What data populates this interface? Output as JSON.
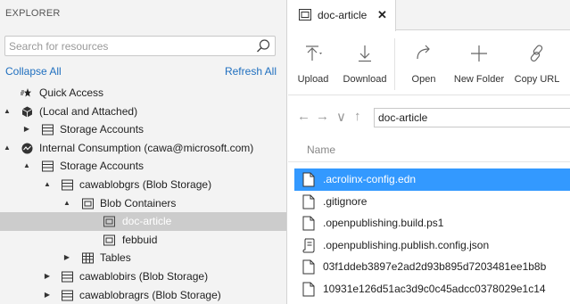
{
  "explorer": {
    "title": "EXPLORER",
    "search_placeholder": "Search for resources",
    "collapse_all": "Collapse All",
    "refresh_all": "Refresh All",
    "tree": [
      {
        "label": "Quick Access",
        "icon": "quick-access-icon",
        "caret": ""
      },
      {
        "label": "(Local and Attached)",
        "icon": "local-attached-icon",
        "caret": "▲"
      },
      {
        "label": "Storage Accounts",
        "icon": "storage-accounts-icon",
        "caret": "▶"
      },
      {
        "label": "Internal Consumption (cawa@microsoft.com)",
        "icon": "subscription-icon",
        "caret": "▲"
      },
      {
        "label": "Storage Accounts",
        "icon": "storage-accounts-icon",
        "caret": "▲"
      },
      {
        "label": "cawablobgrs (Blob Storage)",
        "icon": "storage-account-icon",
        "caret": "▲"
      },
      {
        "label": "Blob Containers",
        "icon": "blob-containers-icon",
        "caret": "▲"
      },
      {
        "label": "doc-article",
        "icon": "container-icon",
        "caret": "",
        "selected": true
      },
      {
        "label": "febbuid",
        "icon": "container-icon",
        "caret": ""
      },
      {
        "label": "Tables",
        "icon": "tables-icon",
        "caret": "▶"
      },
      {
        "label": "cawablobirs (Blob Storage)",
        "icon": "storage-account-icon",
        "caret": "▶"
      },
      {
        "label": "cawablobragrs (Blob Storage)",
        "icon": "storage-account-icon",
        "caret": "▶"
      }
    ]
  },
  "tab": {
    "label": "doc-article",
    "close": "✕"
  },
  "toolbar": {
    "upload": "Upload",
    "download": "Download",
    "open": "Open",
    "new_folder": "New Folder",
    "copy_url": "Copy URL"
  },
  "navbar": {
    "path": "doc-article"
  },
  "list": {
    "header": "Name",
    "files": [
      {
        "name": ".acrolinx-config.edn",
        "icon": "file-icon",
        "selected": true
      },
      {
        "name": ".gitignore",
        "icon": "file-icon"
      },
      {
        "name": ".openpublishing.build.ps1",
        "icon": "file-icon"
      },
      {
        "name": ".openpublishing.publish.config.json",
        "icon": "script-file-icon"
      },
      {
        "name": "03f1ddeb3897e2ad2d93b895d7203481ee1b8b",
        "icon": "file-icon"
      },
      {
        "name": "10931e126d51ac3d9c0c45adcc0378029e1c14",
        "icon": "file-icon"
      }
    ]
  },
  "colors": {
    "selection_blue": "#3399ff",
    "tree_selection": "#cccccc",
    "link": "#1f6fbf"
  }
}
